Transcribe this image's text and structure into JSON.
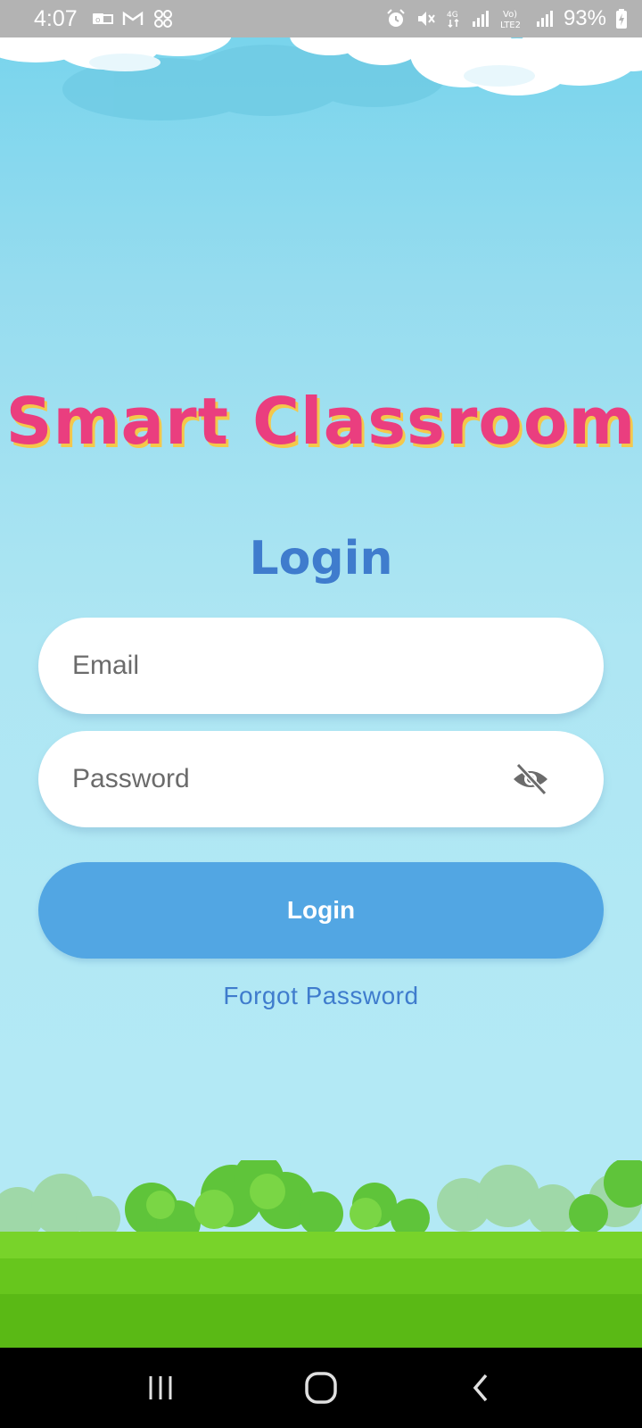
{
  "status_bar": {
    "time": "4:07",
    "battery": "93%",
    "left_icons": [
      "outlook-icon",
      "gmail-icon",
      "apps-icon"
    ],
    "right_icons": [
      "alarm-icon",
      "mute-icon",
      "4g-icon",
      "signal-icon",
      "volte-icon",
      "signal-icon",
      "battery-charging-icon"
    ]
  },
  "app": {
    "title": "Smart Classroom"
  },
  "login": {
    "heading": "Login",
    "email_placeholder": "Email",
    "password_placeholder": "Password",
    "password_toggle_icon": "eye-off-icon",
    "button_label": "Login",
    "forgot_password": "Forgot Password"
  },
  "colors": {
    "title": "#ea3e7f",
    "title_shadow": "#f4c84a",
    "accent": "#3f7ccd",
    "button": "#52a6e3",
    "sky": "#b3e9f5",
    "grass": "#62c21c"
  },
  "nav_bar": {
    "icons": [
      "recent-apps-icon",
      "home-icon",
      "back-icon"
    ]
  }
}
